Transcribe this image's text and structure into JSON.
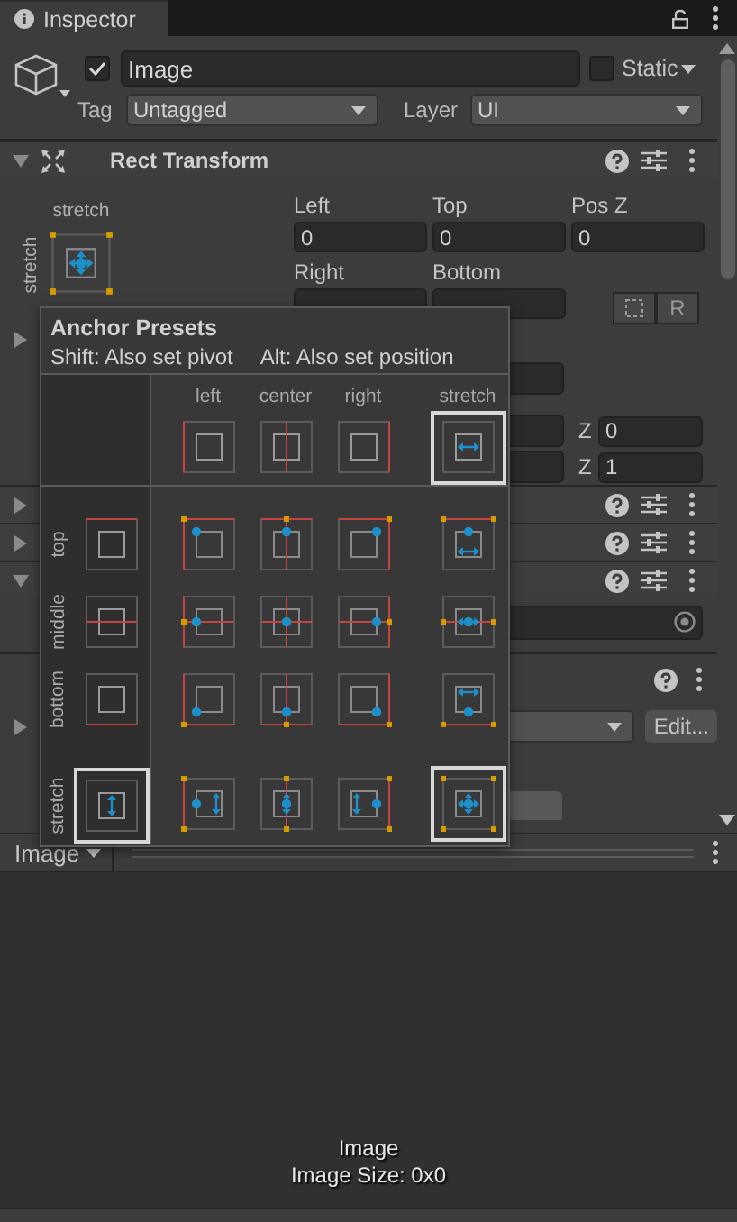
{
  "tab": {
    "title": "Inspector"
  },
  "object": {
    "active": true,
    "name": "Image",
    "static": false,
    "static_label": "Static",
    "tag_label": "Tag",
    "tag": "Untagged",
    "layer_label": "Layer",
    "layer": "UI"
  },
  "rect_transform": {
    "title": "Rect Transform",
    "expanded": true,
    "anchor_h": "stretch",
    "anchor_v": "stretch",
    "raw_button": "R",
    "fields": [
      {
        "label": "Left",
        "value": "0"
      },
      {
        "label": "Top",
        "value": "0"
      },
      {
        "label": "Pos Z",
        "value": "0"
      },
      {
        "label": "Right"
      },
      {
        "label": "Bottom"
      }
    ]
  },
  "covered_rows": [
    {
      "kind": "foldout",
      "expanded": false
    },
    {
      "kind": "field"
    },
    {
      "kind": "vector",
      "axis": "Z",
      "value": "0"
    },
    {
      "kind": "vector",
      "axis": "Z",
      "value": "1"
    },
    {
      "kind": "header",
      "expanded": false
    },
    {
      "kind": "header",
      "expanded": false
    },
    {
      "kind": "header",
      "expanded": true
    },
    {
      "kind": "object_field"
    },
    {
      "kind": "header_plain"
    },
    {
      "kind": "dropdown",
      "expanded": false,
      "button": "Edit..."
    },
    {
      "kind": "button"
    }
  ],
  "anchor_presets": {
    "title": "Anchor Presets",
    "hint_shift": "Shift: Also set pivot",
    "hint_alt": "Alt: Also set position",
    "columns": [
      {
        "label": "left",
        "selected": false
      },
      {
        "label": "center",
        "selected": false
      },
      {
        "label": "right",
        "selected": false
      },
      {
        "label": "stretch",
        "selected": true
      }
    ],
    "rows": [
      {
        "label": "top",
        "selected": false
      },
      {
        "label": "middle",
        "selected": false
      },
      {
        "label": "bottom",
        "selected": false
      },
      {
        "label": "stretch",
        "selected": true
      }
    ]
  },
  "preview": {
    "title": "Image",
    "caption": "Image",
    "size": "Image Size: 0x0"
  }
}
